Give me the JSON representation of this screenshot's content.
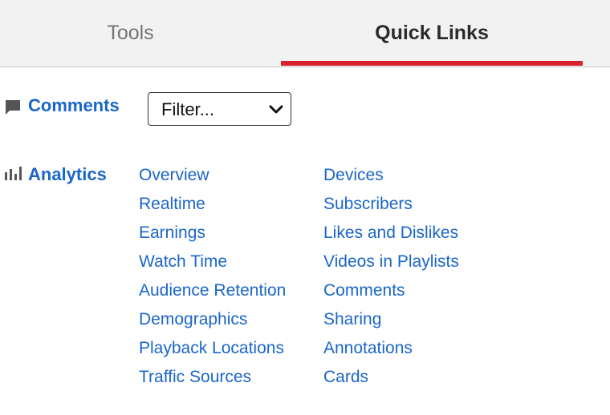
{
  "tabs": {
    "tools_label": "Tools",
    "quick_links_label": "Quick Links",
    "active": "Quick Links",
    "accent_color": "#d6232b"
  },
  "comments": {
    "icon": "comment-icon",
    "title": "Comments",
    "filter_value": "Filter..."
  },
  "analytics": {
    "icon": "bar-chart-icon",
    "title": "Analytics",
    "left_links": [
      "Overview",
      "Realtime",
      "Earnings",
      "Watch Time",
      "Audience Retention",
      "Demographics",
      "Playback Locations",
      "Traffic Sources"
    ],
    "right_links": [
      "Devices",
      "Subscribers",
      "Likes and Dislikes",
      "Videos in Playlists",
      "Comments",
      "Sharing",
      "Annotations",
      "Cards"
    ]
  },
  "colors": {
    "link": "#1a66c9",
    "tab_bar_bg": "#f2f2f2"
  }
}
